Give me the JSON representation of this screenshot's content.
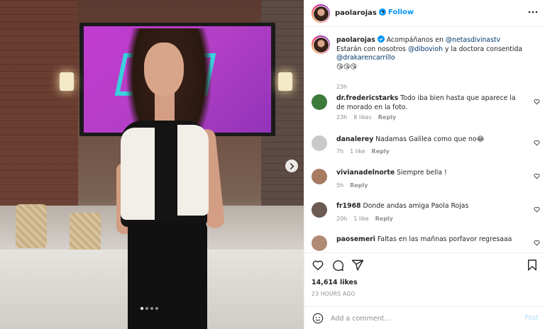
{
  "post": {
    "author": "paolarojas",
    "follow_label": "Follow",
    "dot": "•",
    "caption_mention_1": "@netasdivinastv",
    "caption_part_1": "Acompáñanos en ",
    "caption_part_2": "Estarán con nosotros ",
    "caption_mention_2": "@dibovioh",
    "caption_part_3": " y la doctora consentida",
    "caption_mention_3": "@drakarencarrillo",
    "caption_emojis": "😘😘😘",
    "caption_time": "23h",
    "likes": "14,614 likes",
    "posted_ago": "23 HOURS AGO"
  },
  "comments": [
    {
      "user": "dr.fredericstarks",
      "text": "Todo iba bien hasta que aparece la de morado en la foto.",
      "time": "23h",
      "likes": "8 likes",
      "reply": "Reply"
    },
    {
      "user": "danalerey",
      "text": "Nadamas Galilea como que no😂",
      "time": "7h",
      "likes": "1 like",
      "reply": "Reply"
    },
    {
      "user": "vivianadelnorte",
      "text": "Siempre bella !",
      "time": "5h",
      "likes": "",
      "reply": "Reply"
    },
    {
      "user": "fr1968",
      "text": "Donde andas amiga Paola Rojas",
      "time": "20h",
      "likes": "1 like",
      "reply": "Reply"
    },
    {
      "user": "paosemeri",
      "text": "Faltas en las mañnas porfavor regresaaa",
      "time": "",
      "likes": "",
      "reply": ""
    }
  ],
  "composer": {
    "placeholder": "Add a comment...",
    "post_label": "Post"
  },
  "colors": {
    "accent": "#0095f6",
    "verified": "#0095f6",
    "muted": "#8e8e8e"
  },
  "carousel": {
    "slides": 4,
    "active": 1
  }
}
